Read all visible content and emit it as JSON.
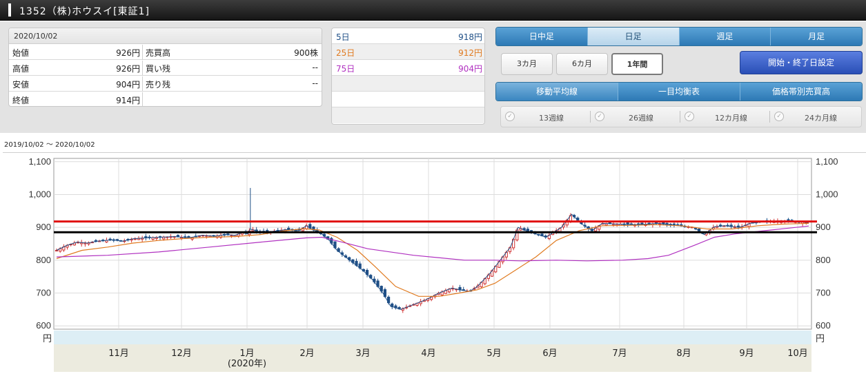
{
  "title": "1352（株)ホウスイ[東証1]",
  "price": {
    "date": "2020/10/02",
    "rows": [
      {
        "label": "始値",
        "value": "926円",
        "label2": "売買高",
        "value2": "900株"
      },
      {
        "label": "高値",
        "value": "926円",
        "label2": "買い残",
        "value2": "--"
      },
      {
        "label": "安値",
        "value": "904円",
        "label2": "売り残",
        "value2": "--"
      },
      {
        "label": "終値",
        "value": "914円",
        "label2": "",
        "value2": ""
      }
    ]
  },
  "ma": [
    {
      "name": "5日",
      "value": "918円",
      "color": "#1f4f86"
    },
    {
      "name": "25日",
      "value": "912円",
      "color": "#e07a1f"
    },
    {
      "name": "75日",
      "value": "904円",
      "color": "#b030c0"
    }
  ],
  "ashi_tabs": [
    {
      "label": "日中足",
      "active": false
    },
    {
      "label": "日足",
      "active": true
    },
    {
      "label": "週足",
      "active": false
    },
    {
      "label": "月足",
      "active": false
    }
  ],
  "range_buttons": [
    {
      "label": "3カ月",
      "active": false
    },
    {
      "label": "6カ月",
      "active": false
    },
    {
      "label": "1年間",
      "active": true
    }
  ],
  "period_button": "開始・終了日設定",
  "indicator_tabs": [
    {
      "label": "移動平均線",
      "active": true
    },
    {
      "label": "一目均衡表",
      "active": false
    },
    {
      "label": "価格帯別売買高",
      "active": false
    }
  ],
  "checks": [
    "13週線",
    "26週線",
    "12カ月線",
    "24カ月線"
  ],
  "date_range": "2019/10/02 ～ 2020/10/02",
  "chart_data": {
    "type": "candlestick",
    "ylim": [
      590,
      1110
    ],
    "y_ticks": [
      "1,100",
      "1,000",
      "900",
      "800",
      "700",
      "600"
    ],
    "y_tick_values": [
      1100,
      1000,
      900,
      800,
      700,
      600
    ],
    "y_unit": "円",
    "x_month_labels": [
      "11月",
      "12月",
      "1月",
      "2月",
      "3月",
      "4月",
      "5月",
      "6月",
      "7月",
      "8月",
      "9月",
      "10月"
    ],
    "year_label": "(2020年)",
    "reference_lines": [
      {
        "value": 918,
        "color": "#e01010"
      },
      {
        "value": 885,
        "color": "#000000"
      }
    ],
    "series": [
      {
        "key": "close",
        "color": "#1f4f86"
      },
      {
        "key": "ma25",
        "color": "#e07a1f"
      },
      {
        "key": "ma75",
        "color": "#b030c0"
      }
    ],
    "close_path": [
      [
        0,
        830
      ],
      [
        4,
        845
      ],
      [
        8,
        855
      ],
      [
        12,
        852
      ],
      [
        16,
        858
      ],
      [
        22,
        862
      ],
      [
        26,
        858
      ],
      [
        30,
        865
      ],
      [
        35,
        868
      ],
      [
        41,
        870
      ],
      [
        46,
        872
      ],
      [
        52,
        868
      ],
      [
        57,
        876
      ],
      [
        62,
        873
      ],
      [
        66,
        878
      ],
      [
        70,
        876
      ],
      [
        73,
        884
      ],
      [
        75,
        880
      ],
      [
        76,
        895
      ],
      [
        80,
        885
      ],
      [
        85,
        888
      ],
      [
        90,
        893
      ],
      [
        95,
        890
      ],
      [
        98,
        905
      ],
      [
        100,
        895
      ],
      [
        104,
        880
      ],
      [
        107,
        860
      ],
      [
        110,
        830
      ],
      [
        115,
        800
      ],
      [
        120,
        770
      ],
      [
        124,
        740
      ],
      [
        128,
        700
      ],
      [
        131,
        660
      ],
      [
        135,
        650
      ],
      [
        140,
        665
      ],
      [
        145,
        680
      ],
      [
        150,
        700
      ],
      [
        155,
        715
      ],
      [
        158,
        710
      ],
      [
        162,
        705
      ],
      [
        165,
        720
      ],
      [
        170,
        760
      ],
      [
        174,
        800
      ],
      [
        178,
        840
      ],
      [
        181,
        900
      ],
      [
        184,
        890
      ],
      [
        188,
        880
      ],
      [
        192,
        870
      ],
      [
        198,
        900
      ],
      [
        202,
        940
      ],
      [
        206,
        910
      ],
      [
        210,
        890
      ],
      [
        214,
        912
      ],
      [
        220,
        910
      ],
      [
        228,
        908
      ],
      [
        236,
        912
      ],
      [
        244,
        905
      ],
      [
        250,
        900
      ],
      [
        254,
        878
      ],
      [
        258,
        902
      ],
      [
        262,
        905
      ],
      [
        268,
        900
      ],
      [
        272,
        912
      ],
      [
        278,
        918
      ],
      [
        284,
        920
      ],
      [
        290,
        918
      ],
      [
        295,
        914
      ]
    ],
    "ma25_path": [
      [
        0,
        805
      ],
      [
        10,
        830
      ],
      [
        20,
        840
      ],
      [
        30,
        852
      ],
      [
        40,
        860
      ],
      [
        50,
        866
      ],
      [
        60,
        870
      ],
      [
        70,
        872
      ],
      [
        80,
        878
      ],
      [
        90,
        890
      ],
      [
        97,
        896
      ],
      [
        103,
        892
      ],
      [
        110,
        870
      ],
      [
        118,
        830
      ],
      [
        125,
        780
      ],
      [
        133,
        720
      ],
      [
        142,
        690
      ],
      [
        150,
        690
      ],
      [
        158,
        700
      ],
      [
        165,
        710
      ],
      [
        172,
        730
      ],
      [
        180,
        770
      ],
      [
        188,
        810
      ],
      [
        196,
        860
      ],
      [
        205,
        890
      ],
      [
        214,
        905
      ],
      [
        224,
        906
      ],
      [
        235,
        908
      ],
      [
        245,
        905
      ],
      [
        255,
        895
      ],
      [
        265,
        895
      ],
      [
        275,
        905
      ],
      [
        285,
        910
      ],
      [
        295,
        912
      ]
    ],
    "ma75_path": [
      [
        0,
        810
      ],
      [
        20,
        815
      ],
      [
        40,
        825
      ],
      [
        60,
        840
      ],
      [
        80,
        855
      ],
      [
        98,
        868
      ],
      [
        104,
        870
      ],
      [
        112,
        855
      ],
      [
        122,
        835
      ],
      [
        140,
        815
      ],
      [
        160,
        800
      ],
      [
        172,
        800
      ],
      [
        182,
        798
      ],
      [
        196,
        800
      ],
      [
        208,
        798
      ],
      [
        222,
        800
      ],
      [
        232,
        805
      ],
      [
        240,
        815
      ],
      [
        250,
        845
      ],
      [
        258,
        870
      ],
      [
        266,
        880
      ],
      [
        278,
        890
      ],
      [
        295,
        904
      ]
    ]
  }
}
